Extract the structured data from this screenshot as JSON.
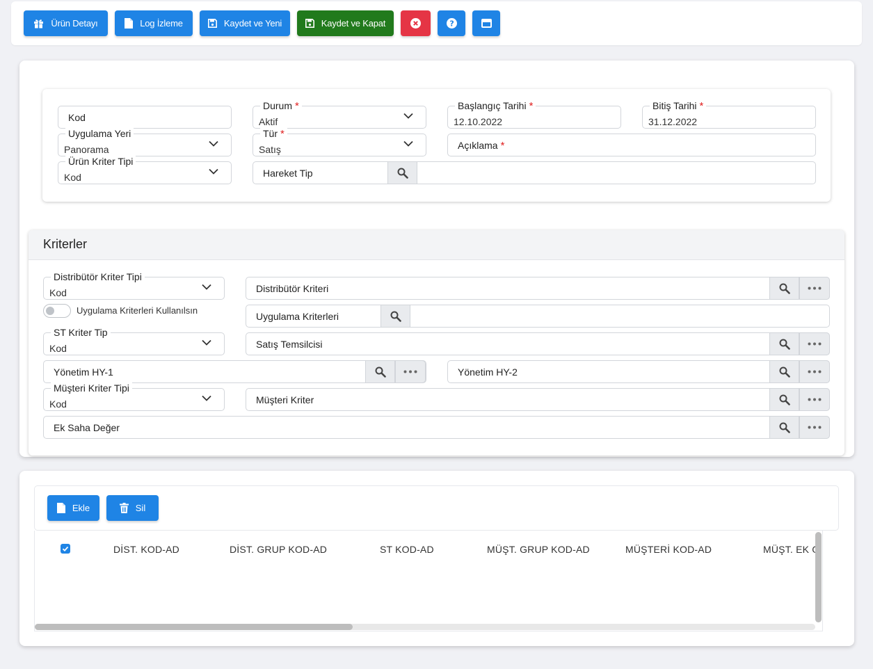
{
  "toolbar": {
    "urun_detayi": "Ürün Detayı",
    "log_izleme": "Log İzleme",
    "kaydet_yeni": "Kaydet ve Yeni",
    "kaydet_kapat": "Kaydet ve Kapat"
  },
  "form": {
    "kod": {
      "label": "Kod"
    },
    "durum": {
      "label": "Durum",
      "value": "Aktif"
    },
    "baslangic": {
      "label": "Başlangıç Tarihi",
      "value": "12.10.2022"
    },
    "bitis": {
      "label": "Bitiş Tarihi",
      "value": "31.12.2022"
    },
    "uygulama_yeri": {
      "label": "Uygulama Yeri",
      "value": "Panorama"
    },
    "tur": {
      "label": "Tür",
      "value": "Satış"
    },
    "aciklama": {
      "label": "Açıklama"
    },
    "urun_kriter_tipi": {
      "label": "Ürün Kriter Tipi",
      "value": "Kod"
    },
    "hareket_tip": {
      "label": "Hareket Tip"
    },
    "required_mark": "*"
  },
  "kriterler": {
    "title": "Kriterler",
    "dist_kriter_tipi": {
      "label": "Distribütör Kriter Tipi",
      "value": "Kod"
    },
    "dist_kriteri": {
      "label": "Distribütör Kriteri"
    },
    "toggle_label": "Uygulama Kriterleri Kullanılsın",
    "uygulama_kriterleri": {
      "label": "Uygulama Kriterleri"
    },
    "st_kriter_tip": {
      "label": "ST Kriter Tip",
      "value": "Kod"
    },
    "satis_temsilcisi": {
      "label": "Satış Temsilcisi"
    },
    "yonetim_hy1": {
      "label": "Yönetim HY-1"
    },
    "yonetim_hy2": {
      "label": "Yönetim HY-2"
    },
    "musteri_kriter_tipi": {
      "label": "Müşteri Kriter Tipi",
      "value": "Kod"
    },
    "musteri_kriter": {
      "label": "Müşteri Kriter"
    },
    "ek_saha": {
      "label": "Ek Saha Değer"
    }
  },
  "grid": {
    "ekle": "Ekle",
    "sil": "Sil",
    "columns": [
      "DİST. KOD-AD",
      "DİST. GRUP KOD-AD",
      "ST KOD-AD",
      "MÜŞT. GRUP KOD-AD",
      "MÜŞTERİ KOD-AD",
      "MÜŞT. EK G"
    ]
  },
  "colors": {
    "primary": "#1f84e5",
    "success": "#217a1c",
    "danger": "#e53545",
    "required": "#e02020"
  }
}
